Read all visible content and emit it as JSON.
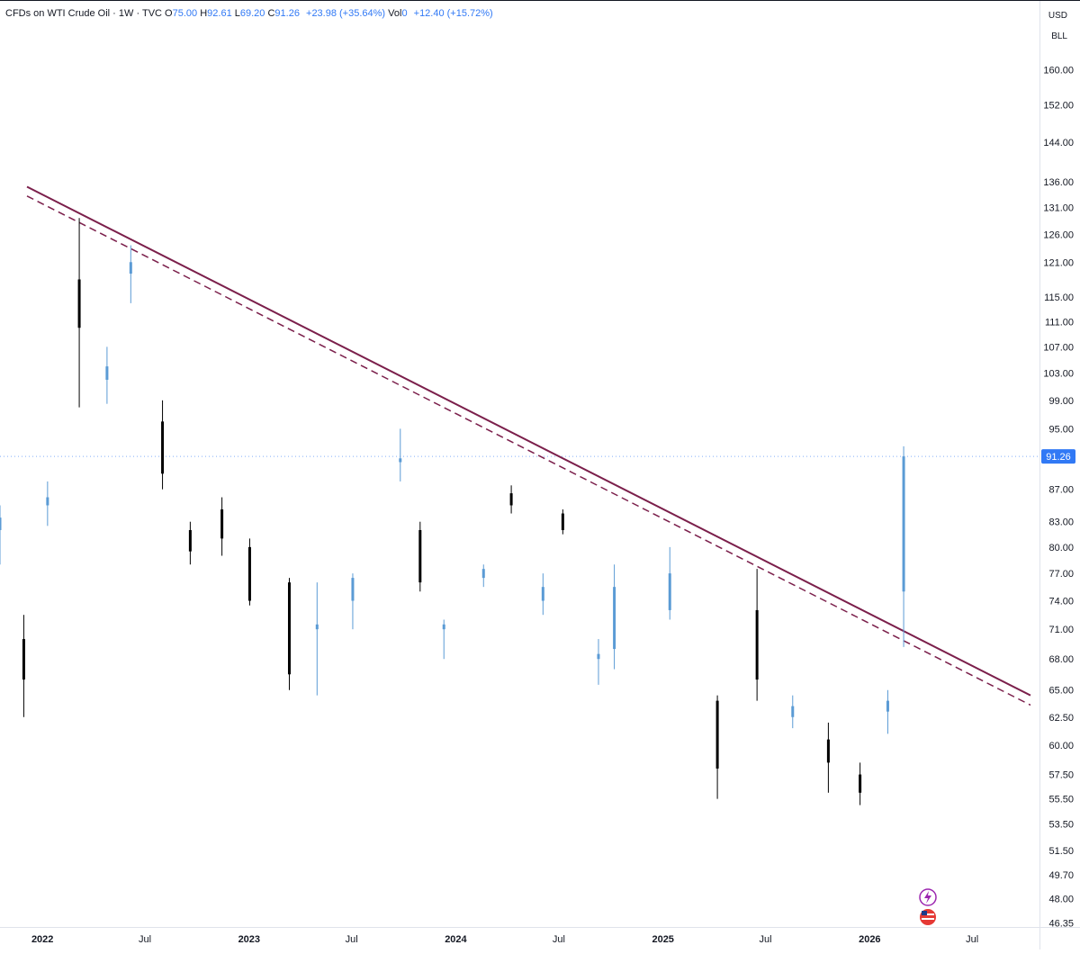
{
  "header": {
    "symbol": "CFDs on WTI Crude Oil · 1W · TVC",
    "open_label": "O",
    "open": "75.00",
    "high_label": "H",
    "high": "92.61",
    "low_label": "L",
    "low": "69.20",
    "close_label": "C",
    "close": "91.26",
    "change": "+23.98 (+35.64%)",
    "vol_label": "Vol",
    "vol": "0",
    "vol_change": "+12.40 (+15.72%)"
  },
  "price_scale": {
    "currency": "USD",
    "unit": "BLL",
    "current_price_label": "91.26"
  },
  "colors": {
    "up": "#5b9bd5",
    "down": "#000000",
    "trendline": "#7b1f4b",
    "price_tag": "#3179f5"
  },
  "chart_data": {
    "type": "candlestick",
    "interval": "1W",
    "scale": "log",
    "y_ticks": [
      46.35,
      48.0,
      49.7,
      51.5,
      53.5,
      55.5,
      57.5,
      60.0,
      62.5,
      65.0,
      68.0,
      71.0,
      74.0,
      77.0,
      80.0,
      83.0,
      87.0,
      91.26,
      95.0,
      99.0,
      103.0,
      107.0,
      111.0,
      115.0,
      121.0,
      126.0,
      131.0,
      136.0,
      144.0,
      152.0,
      160.0
    ],
    "y_tick_labels": [
      "46.35",
      "48.00",
      "49.70",
      "51.50",
      "53.50",
      "55.50",
      "57.50",
      "60.00",
      "62.50",
      "65.00",
      "68.00",
      "71.00",
      "74.00",
      "77.00",
      "80.00",
      "83.00",
      "87.00",
      "91.26",
      "95.00",
      "99.00",
      "103.00",
      "107.00",
      "111.00",
      "115.00",
      "121.00",
      "126.00",
      "131.00",
      "136.00",
      "144.00",
      "152.00",
      "160.00"
    ],
    "x_ticks": [
      "2022-01-01",
      "2022-07-01",
      "2023-01-01",
      "2023-07-01",
      "2024-01-01",
      "2024-07-01",
      "2025-01-01",
      "2025-07-01",
      "2026-01-01",
      "2026-07-01"
    ],
    "x_tick_labels": [
      "2022",
      "Jul",
      "2023",
      "Jul",
      "2024",
      "Jul",
      "2025",
      "Jul",
      "2026",
      "Jul"
    ],
    "x_range": [
      "2021-10-18",
      "2026-10-12"
    ],
    "candles": [
      {
        "d": "2021-10-18",
        "o": 82.0,
        "h": 85.0,
        "l": 78.0,
        "c": 83.5
      },
      {
        "d": "2021-11-29",
        "o": 70.0,
        "h": 72.5,
        "l": 62.5,
        "c": 66.0
      },
      {
        "d": "2022-01-10",
        "o": 85.0,
        "h": 88.0,
        "l": 82.5,
        "c": 86.0
      },
      {
        "d": "2022-03-07",
        "o": 118.0,
        "h": 129.0,
        "l": 98.0,
        "c": 110.0
      },
      {
        "d": "2022-04-25",
        "o": 102.0,
        "h": 107.0,
        "l": 98.5,
        "c": 104.0
      },
      {
        "d": "2022-06-06",
        "o": 119.0,
        "h": 124.0,
        "l": 114.0,
        "c": 121.0
      },
      {
        "d": "2022-08-01",
        "o": 96.0,
        "h": 99.0,
        "l": 87.0,
        "c": 89.0
      },
      {
        "d": "2022-09-19",
        "o": 82.0,
        "h": 83.0,
        "l": 78.0,
        "c": 79.5
      },
      {
        "d": "2022-11-14",
        "o": 84.5,
        "h": 86.0,
        "l": 79.0,
        "c": 81.0
      },
      {
        "d": "2023-01-02",
        "o": 80.0,
        "h": 81.0,
        "l": 73.5,
        "c": 74.0
      },
      {
        "d": "2023-03-13",
        "o": 76.0,
        "h": 76.5,
        "l": 65.0,
        "c": 66.5
      },
      {
        "d": "2023-05-01",
        "o": 71.0,
        "h": 76.0,
        "l": 64.5,
        "c": 71.5
      },
      {
        "d": "2023-07-03",
        "o": 74.0,
        "h": 77.0,
        "l": 71.0,
        "c": 76.5
      },
      {
        "d": "2023-09-25",
        "o": 90.5,
        "h": 95.0,
        "l": 88.0,
        "c": 91.0
      },
      {
        "d": "2023-10-30",
        "o": 82.0,
        "h": 83.0,
        "l": 75.0,
        "c": 76.0
      },
      {
        "d": "2023-12-11",
        "o": 71.0,
        "h": 72.0,
        "l": 68.0,
        "c": 71.5
      },
      {
        "d": "2024-02-19",
        "o": 76.5,
        "h": 78.0,
        "l": 75.5,
        "c": 77.5
      },
      {
        "d": "2024-04-08",
        "o": 86.5,
        "h": 87.5,
        "l": 84.0,
        "c": 85.0
      },
      {
        "d": "2024-06-03",
        "o": 74.0,
        "h": 77.0,
        "l": 72.5,
        "c": 75.5
      },
      {
        "d": "2024-07-08",
        "o": 84.0,
        "h": 84.5,
        "l": 81.5,
        "c": 82.0
      },
      {
        "d": "2024-09-09",
        "o": 68.0,
        "h": 70.0,
        "l": 65.5,
        "c": 68.5
      },
      {
        "d": "2024-10-07",
        "o": 69.0,
        "h": 78.0,
        "l": 67.0,
        "c": 75.5
      },
      {
        "d": "2025-01-13",
        "o": 73.0,
        "h": 80.0,
        "l": 72.0,
        "c": 77.0
      },
      {
        "d": "2025-04-07",
        "o": 64.0,
        "h": 64.5,
        "l": 55.5,
        "c": 58.0
      },
      {
        "d": "2025-06-16",
        "o": 73.0,
        "h": 77.5,
        "l": 64.0,
        "c": 66.0
      },
      {
        "d": "2025-08-18",
        "o": 62.5,
        "h": 64.5,
        "l": 61.5,
        "c": 63.5
      },
      {
        "d": "2025-10-20",
        "o": 60.5,
        "h": 62.0,
        "l": 56.0,
        "c": 58.5
      },
      {
        "d": "2025-12-15",
        "o": 57.5,
        "h": 58.5,
        "l": 55.0,
        "c": 56.0
      },
      {
        "d": "2026-02-02",
        "o": 63.0,
        "h": 65.0,
        "l": 61.0,
        "c": 64.0
      },
      {
        "d": "2026-03-02",
        "o": 75.0,
        "h": 92.61,
        "l": 69.2,
        "c": 91.26
      }
    ],
    "trendline": {
      "x1": "2021-10-18",
      "y1": 135.0,
      "x2": "2026-10-12",
      "y2": 64.5
    },
    "trendline_parallel": {
      "x1": "2021-10-18",
      "y1": 133.2,
      "x2": "2026-10-12",
      "y2": 63.6
    }
  }
}
